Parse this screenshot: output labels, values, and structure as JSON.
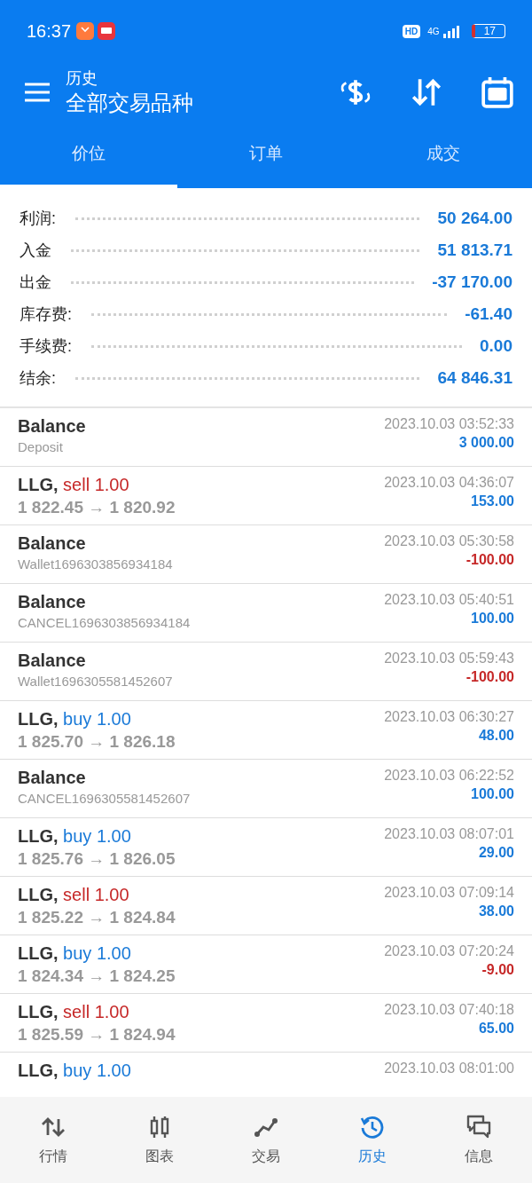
{
  "status_bar": {
    "time": "16:37",
    "hd": "HD",
    "network": "4G",
    "battery": "17"
  },
  "toolbar": {
    "subtitle": "历史",
    "title": "全部交易品种"
  },
  "tabs": [
    {
      "label": "价位",
      "selected": true
    },
    {
      "label": "订单",
      "selected": false
    },
    {
      "label": "成交",
      "selected": false
    }
  ],
  "summary": [
    {
      "label": "利润:",
      "value": "50 264.00"
    },
    {
      "label": "入金",
      "value": "51 813.71"
    },
    {
      "label": "出金",
      "value": "-37 170.00"
    },
    {
      "label": "库存费:",
      "value": "-61.40"
    },
    {
      "label": "手续费:",
      "value": "0.00"
    },
    {
      "label": "结余:",
      "value": "64 846.31"
    }
  ],
  "deals": [
    {
      "kind": "balance",
      "title": "Balance",
      "detail": "Deposit",
      "time": "2023.10.03 03:52:33",
      "amount": "3 000.00",
      "loss": false
    },
    {
      "kind": "sell",
      "title": "LLG,",
      "side": "sell 1.00",
      "detail": "1 822.45 → 1 820.92",
      "time": "2023.10.03 04:36:07",
      "amount": "153.00",
      "loss": false
    },
    {
      "kind": "balance",
      "title": "Balance",
      "detail": "Wallet1696303856934184",
      "time": "2023.10.03 05:30:58",
      "amount": "-100.00",
      "loss": true
    },
    {
      "kind": "balance",
      "title": "Balance",
      "detail": "CANCEL1696303856934184",
      "time": "2023.10.03 05:40:51",
      "amount": "100.00",
      "loss": false
    },
    {
      "kind": "balance",
      "title": "Balance",
      "detail": "Wallet1696305581452607",
      "time": "2023.10.03 05:59:43",
      "amount": "-100.00",
      "loss": true
    },
    {
      "kind": "buy",
      "title": "LLG,",
      "side": "buy 1.00",
      "detail": "1 825.70 → 1 826.18",
      "time": "2023.10.03 06:30:27",
      "amount": "48.00",
      "loss": false
    },
    {
      "kind": "balance",
      "title": "Balance",
      "detail": "CANCEL1696305581452607",
      "time": "2023.10.03 06:22:52",
      "amount": "100.00",
      "loss": false
    },
    {
      "kind": "buy",
      "title": "LLG,",
      "side": "buy 1.00",
      "detail": "1 825.76 → 1 826.05",
      "time": "2023.10.03 08:07:01",
      "amount": "29.00",
      "loss": false
    },
    {
      "kind": "sell",
      "title": "LLG,",
      "side": "sell 1.00",
      "detail": "1 825.22 → 1 824.84",
      "time": "2023.10.03 07:09:14",
      "amount": "38.00",
      "loss": false
    },
    {
      "kind": "buy",
      "title": "LLG,",
      "side": "buy 1.00",
      "detail": "1 824.34 → 1 824.25",
      "time": "2023.10.03 07:20:24",
      "amount": "-9.00",
      "loss": true
    },
    {
      "kind": "sell",
      "title": "LLG,",
      "side": "sell 1.00",
      "detail": "1 825.59 → 1 824.94",
      "time": "2023.10.03 07:40:18",
      "amount": "65.00",
      "loss": false
    },
    {
      "kind": "buy",
      "title": "LLG,",
      "side": "buy 1.00",
      "time": "2023.10.03 08:01:00"
    }
  ],
  "nav": [
    {
      "label": "行情",
      "selected": false
    },
    {
      "label": "图表",
      "selected": false
    },
    {
      "label": "交易",
      "selected": false
    },
    {
      "label": "历史",
      "selected": true
    },
    {
      "label": "信息",
      "selected": false
    }
  ]
}
